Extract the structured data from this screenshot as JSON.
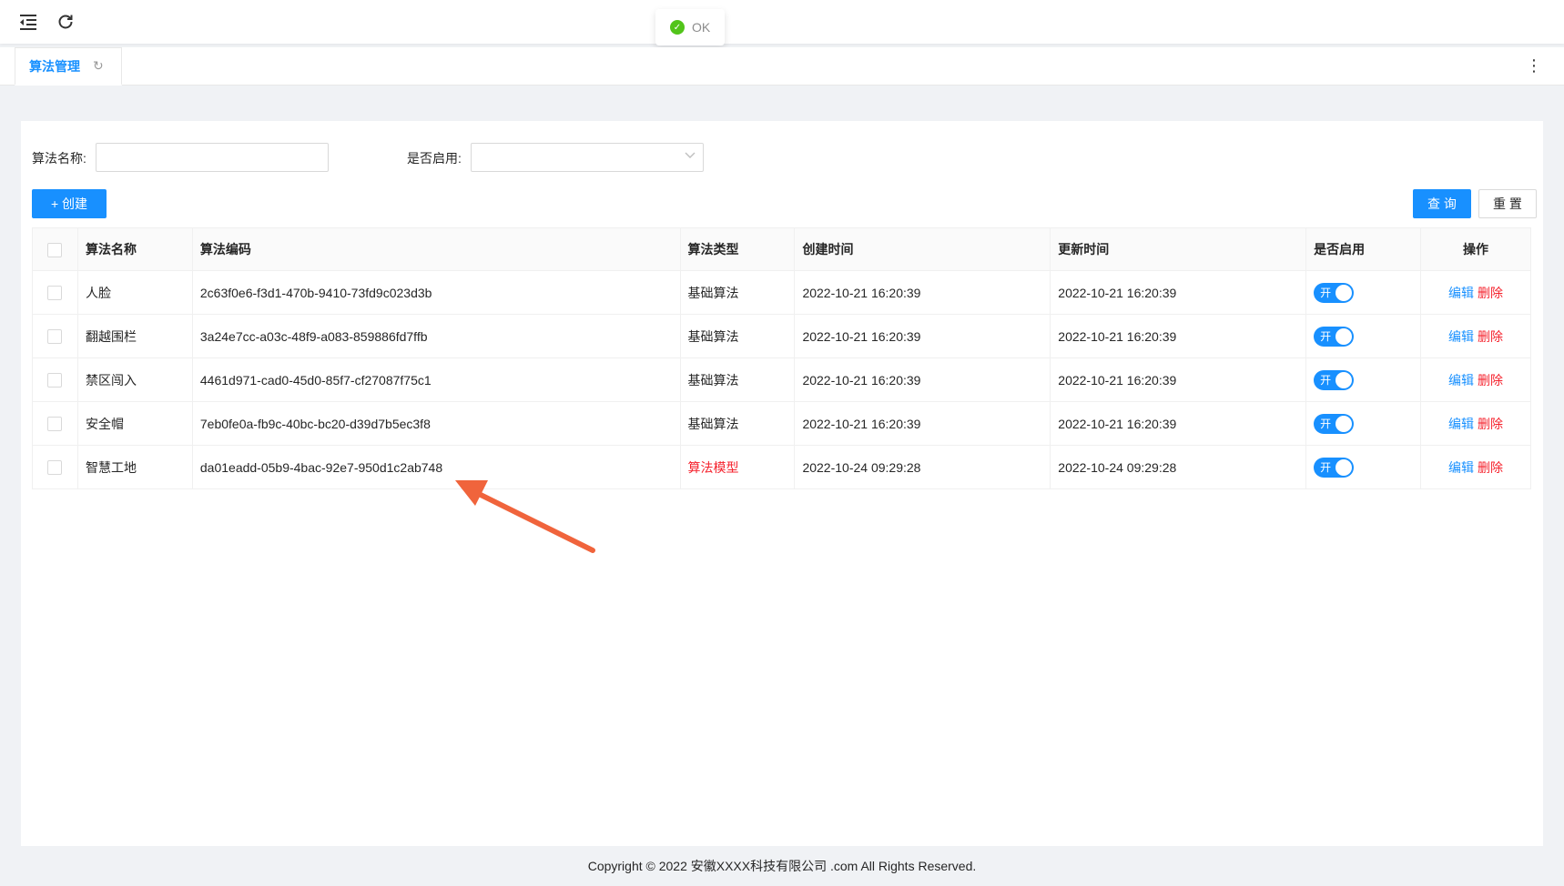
{
  "header": {
    "menu_icon": "menu-fold-icon",
    "reload_icon": "reload-icon",
    "toast_text": "OK"
  },
  "tabs": {
    "active_label": "算法管理",
    "more_icon": "more-vertical-icon"
  },
  "filters": {
    "name_label": "算法名称:",
    "name_value": "",
    "enabled_label": "是否启用:",
    "enabled_value": ""
  },
  "toolbar": {
    "create_label": "+ 创建",
    "query_label": "查 询",
    "reset_label": "重 置"
  },
  "table": {
    "columns": [
      "算法名称",
      "算法编码",
      "算法类型",
      "创建时间",
      "更新时间",
      "是否启用",
      "操作"
    ],
    "rows": [
      {
        "name": "人脸",
        "code": "2c63f0e6-f3d1-470b-9410-73fd9c023d3b",
        "type": "基础算法",
        "created": "2022-10-21 16:20:39",
        "updated": "2022-10-21 16:20:39",
        "enabled": "开"
      },
      {
        "name": "翻越围栏",
        "code": "3a24e7cc-a03c-48f9-a083-859886fd7ffb",
        "type": "基础算法",
        "created": "2022-10-21 16:20:39",
        "updated": "2022-10-21 16:20:39",
        "enabled": "开"
      },
      {
        "name": "禁区闯入",
        "code": "4461d971-cad0-45d0-85f7-cf27087f75c1",
        "type": "基础算法",
        "created": "2022-10-21 16:20:39",
        "updated": "2022-10-21 16:20:39",
        "enabled": "开"
      },
      {
        "name": "安全帽",
        "code": "7eb0fe0a-fb9c-40bc-bc20-d39d7b5ec3f8",
        "type": "基础算法",
        "created": "2022-10-21 16:20:39",
        "updated": "2022-10-21 16:20:39",
        "enabled": "开"
      },
      {
        "name": "智慧工地",
        "code": "da01eadd-05b9-4bac-92e7-950d1c2ab748",
        "type": "算法模型",
        "created": "2022-10-24 09:29:28",
        "updated": "2022-10-24 09:29:28",
        "enabled": "开"
      }
    ],
    "edit_label": "编辑",
    "delete_label": "删除"
  },
  "footer": {
    "copyright": "Copyright © 2022 安徽XXXX科技有限公司 .com All Rights Reserved."
  },
  "colors": {
    "primary": "#1890ff",
    "danger": "#f5222d",
    "annotation_arrow": "#f0643c"
  }
}
